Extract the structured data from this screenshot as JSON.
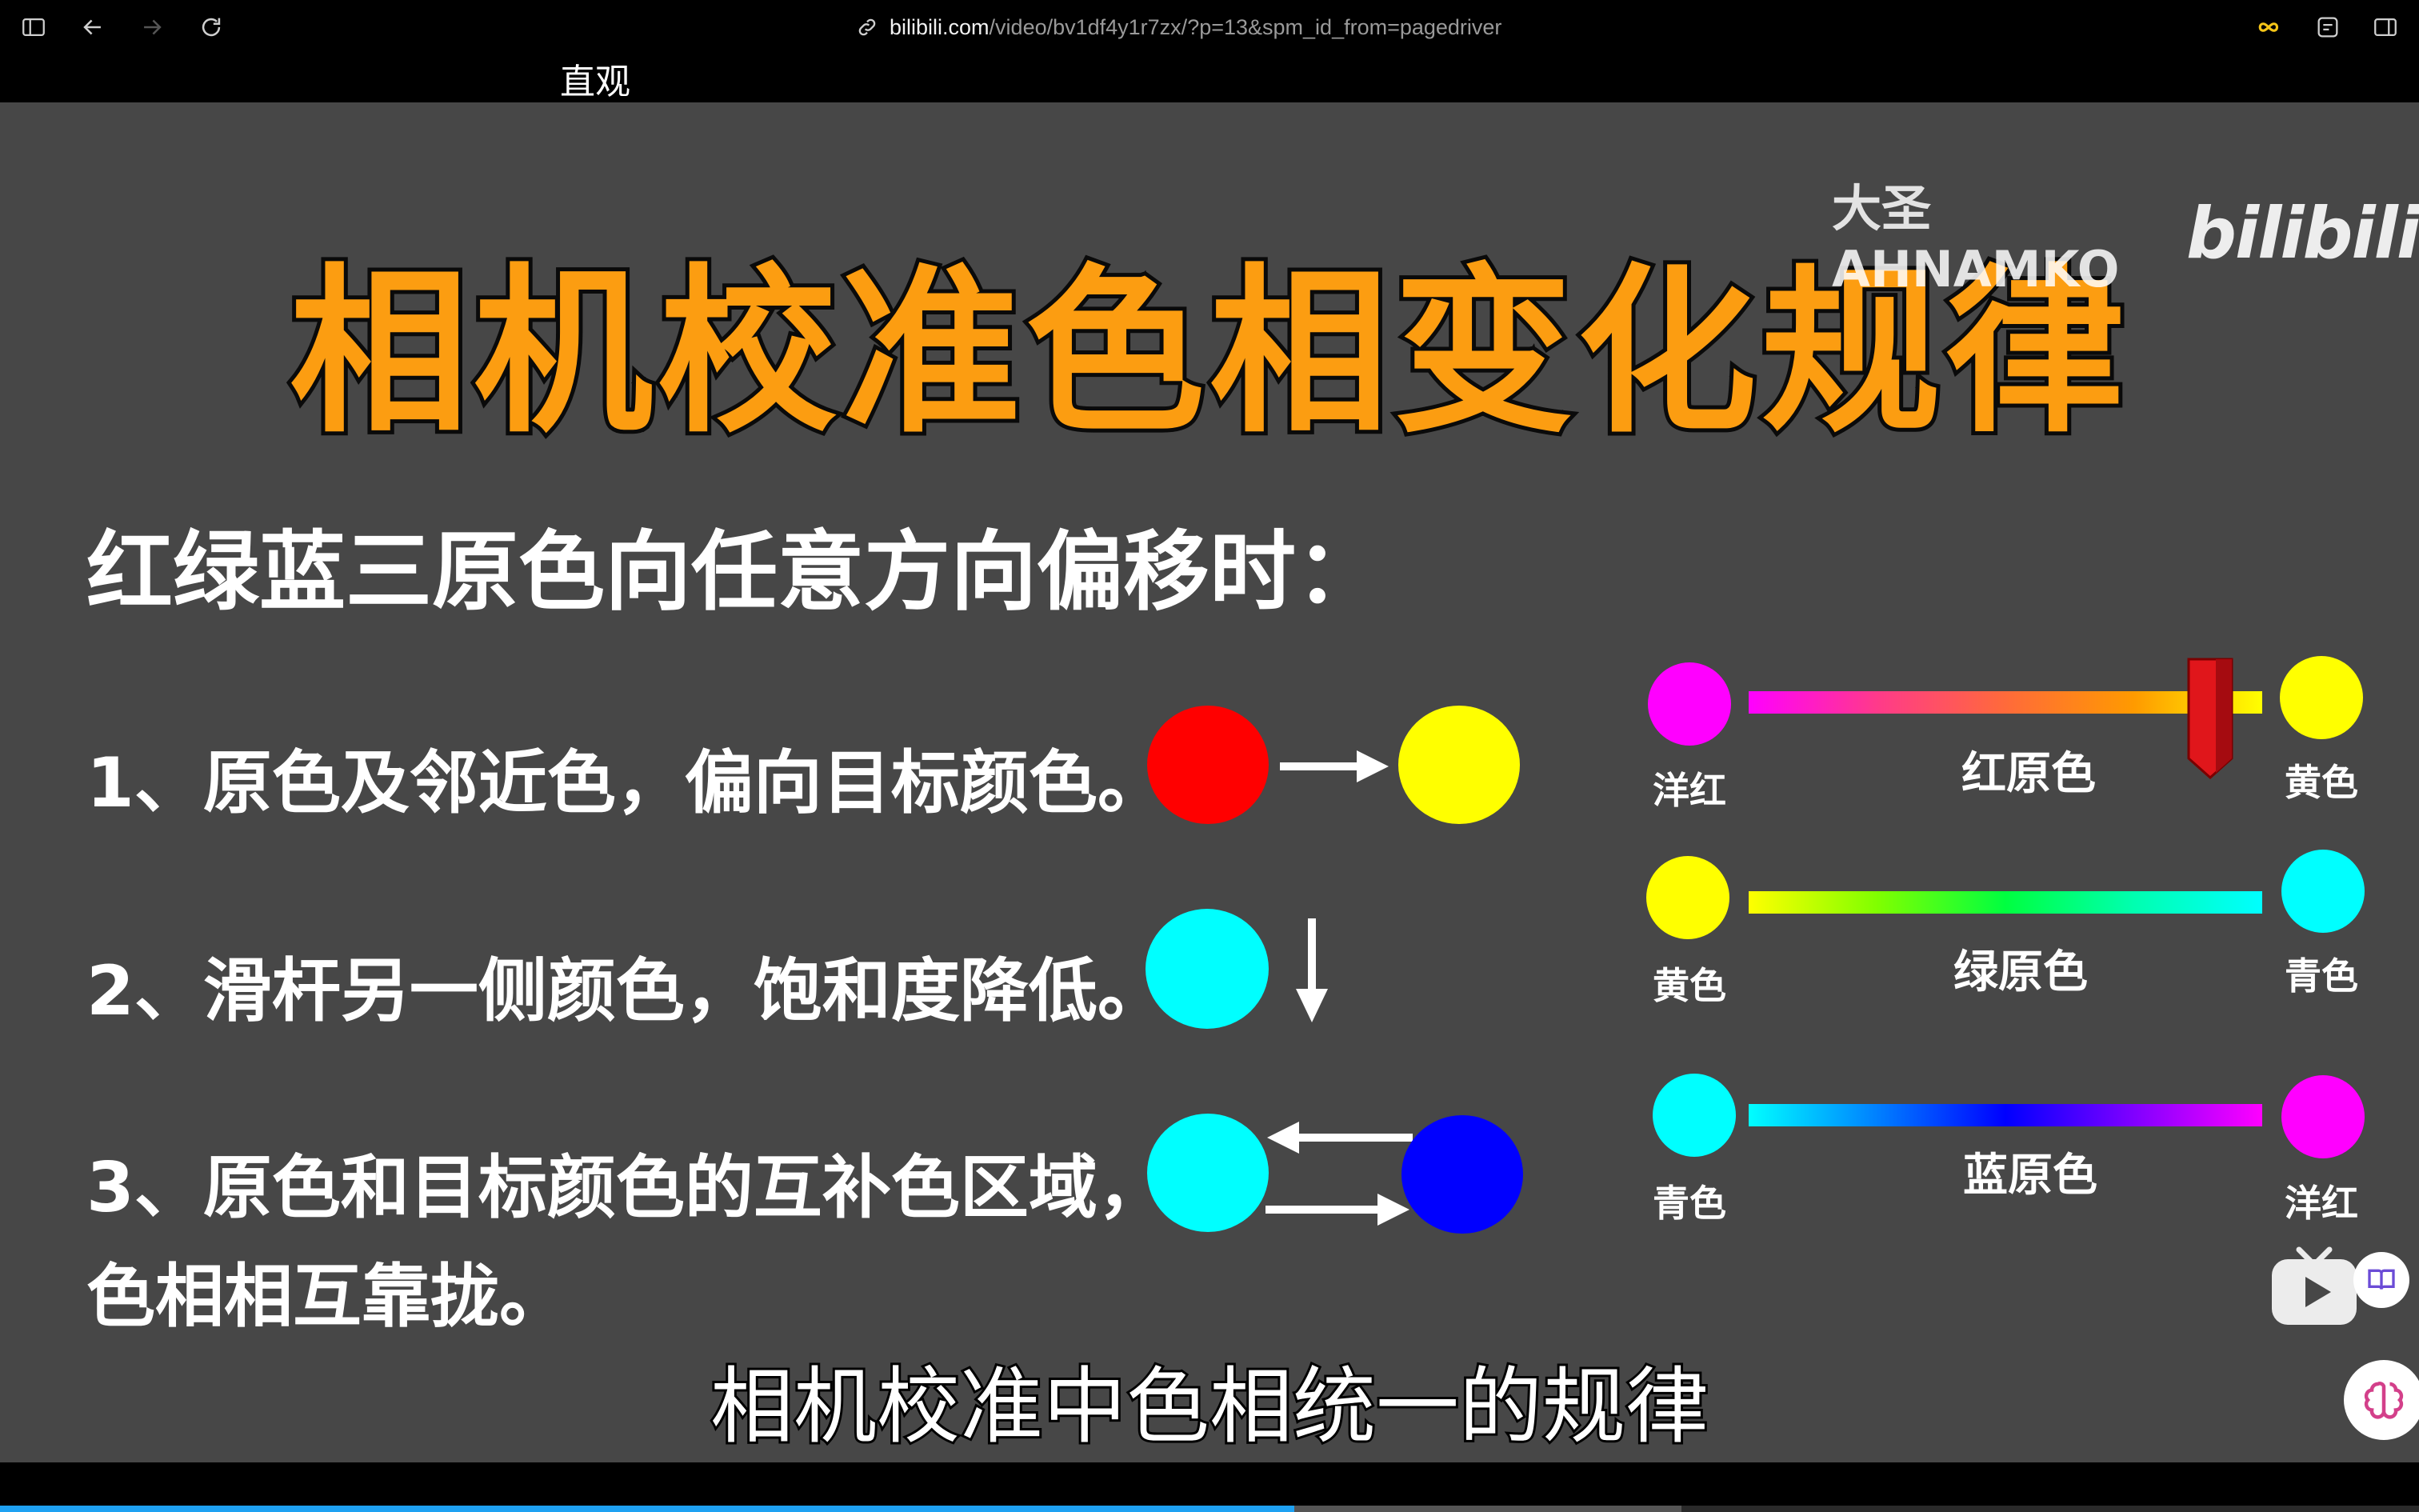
{
  "browser": {
    "url_host": "bilibili.com",
    "url_path": "/video/bv1df4y1r7zx/?p=13&spm_id_from=pagedriver",
    "tab_title": "直观"
  },
  "slide": {
    "title": "相机校准色相变化规律",
    "watermark_author": "大圣AHNAMKO",
    "watermark_logo": "bilibili",
    "heading": "红绿蓝三原色向任意方向偏移时：",
    "rules": [
      {
        "text": "1、原色及邻近色，偏向目标颜色。",
        "colors": [
          "#ff0000",
          "#ffff00"
        ]
      },
      {
        "text": "2、滑杆另一侧颜色，饱和度降低。",
        "colors": [
          "#ff00ff"
        ]
      },
      {
        "text_line1": "3、原色和目标颜色的互补色区域，",
        "text_line2": "色相相互靠拢。",
        "colors": [
          "#00ffff",
          "#0000ff"
        ]
      }
    ],
    "sliders": [
      {
        "name": "红原色",
        "left_label": "洋红",
        "right_label": "黄色",
        "left_color": "#ff00ff",
        "right_color": "#ffff00",
        "gradient": [
          "#ff00ff",
          "#ff3a8a",
          "#ff6a3a",
          "#ff9a00",
          "#ffff00"
        ],
        "handle_color": "#e0161b"
      },
      {
        "name": "绿原色",
        "left_label": "黄色",
        "right_label": "青色",
        "left_color": "#ffff00",
        "right_color": "#00ffff",
        "gradient": [
          "#ffff00",
          "#80ff00",
          "#00ff40",
          "#00ffb0",
          "#00ffff"
        ]
      },
      {
        "name": "蓝原色",
        "left_label": "青色",
        "right_label": "洋红",
        "left_color": "#00ffff",
        "right_color": "#ff00ff",
        "gradient": [
          "#00ffff",
          "#0080ff",
          "#0000ff",
          "#8000ff",
          "#ff00ff"
        ]
      }
    ],
    "subtitle": "相机校准中色相统一的规律"
  },
  "player": {
    "progress": 0.535,
    "buffered": 0.695,
    "progress_color": "#1ea1f2"
  },
  "icons": [
    "sidebar-icon",
    "back-icon",
    "forward-icon",
    "reload-icon",
    "link-icon",
    "infinity-icon",
    "tab-overview-icon",
    "split-view-icon",
    "tv-icon",
    "reader-icon",
    "brain-icon"
  ]
}
